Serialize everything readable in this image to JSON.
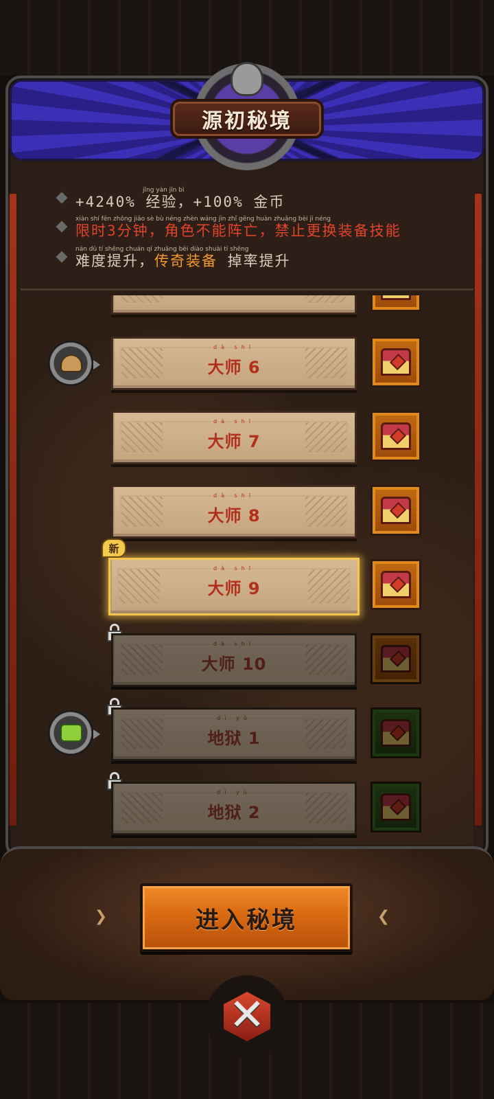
{
  "header": {
    "title": "源初秘境"
  },
  "info": {
    "line1": {
      "text": "+4240% 经验，+100% 金币",
      "pinyin": "jīng yàn        jīn bì"
    },
    "line2": {
      "text": "限时3分钟，角色不能阵亡，禁止更换装备技能",
      "pinyin": "xiàn shí  fēn zhōng  jiǎo sè bù néng zhèn wáng  jìn zhǐ gēng huàn zhuāng bèi jì néng"
    },
    "line3": {
      "before": "难度提升，",
      "highlight": "传奇装备",
      "after": " 掉率提升",
      "pinyin": "nán dù tí shēng   chuán qí zhuāng bèi  diào shuài tí shēng"
    }
  },
  "levels": [
    {
      "label": "",
      "state": "unlocked",
      "chest": "orange"
    },
    {
      "label": "大师 6",
      "pinyin": "dà shī",
      "state": "unlocked",
      "chest": "orange",
      "reward_icon": "hat-icon"
    },
    {
      "label": "大师 7",
      "pinyin": "dà shī",
      "state": "unlocked",
      "chest": "orange"
    },
    {
      "label": "大师 8",
      "pinyin": "dà shī",
      "state": "unlocked",
      "chest": "orange"
    },
    {
      "label": "大师 9",
      "pinyin": "dà shī",
      "state": "selected",
      "chest": "orange",
      "badge": "新"
    },
    {
      "label": "大师 10",
      "pinyin": "dà shī",
      "state": "locked",
      "chest": "orange"
    },
    {
      "label": "地狱 1",
      "pinyin": "dì yù",
      "state": "locked",
      "chest": "green",
      "reward_icon": "shirt-icon"
    },
    {
      "label": "地狱 2",
      "pinyin": "dì yù",
      "state": "locked",
      "chest": "green"
    }
  ],
  "footer": {
    "enter_button": "进入秘境",
    "left_arrow": "❯",
    "right_arrow": "❮",
    "close": "✕"
  },
  "colors": {
    "accent_orange": "#e07418",
    "locked_red": "#e1442c",
    "gold_highlight": "#f6c64f"
  }
}
